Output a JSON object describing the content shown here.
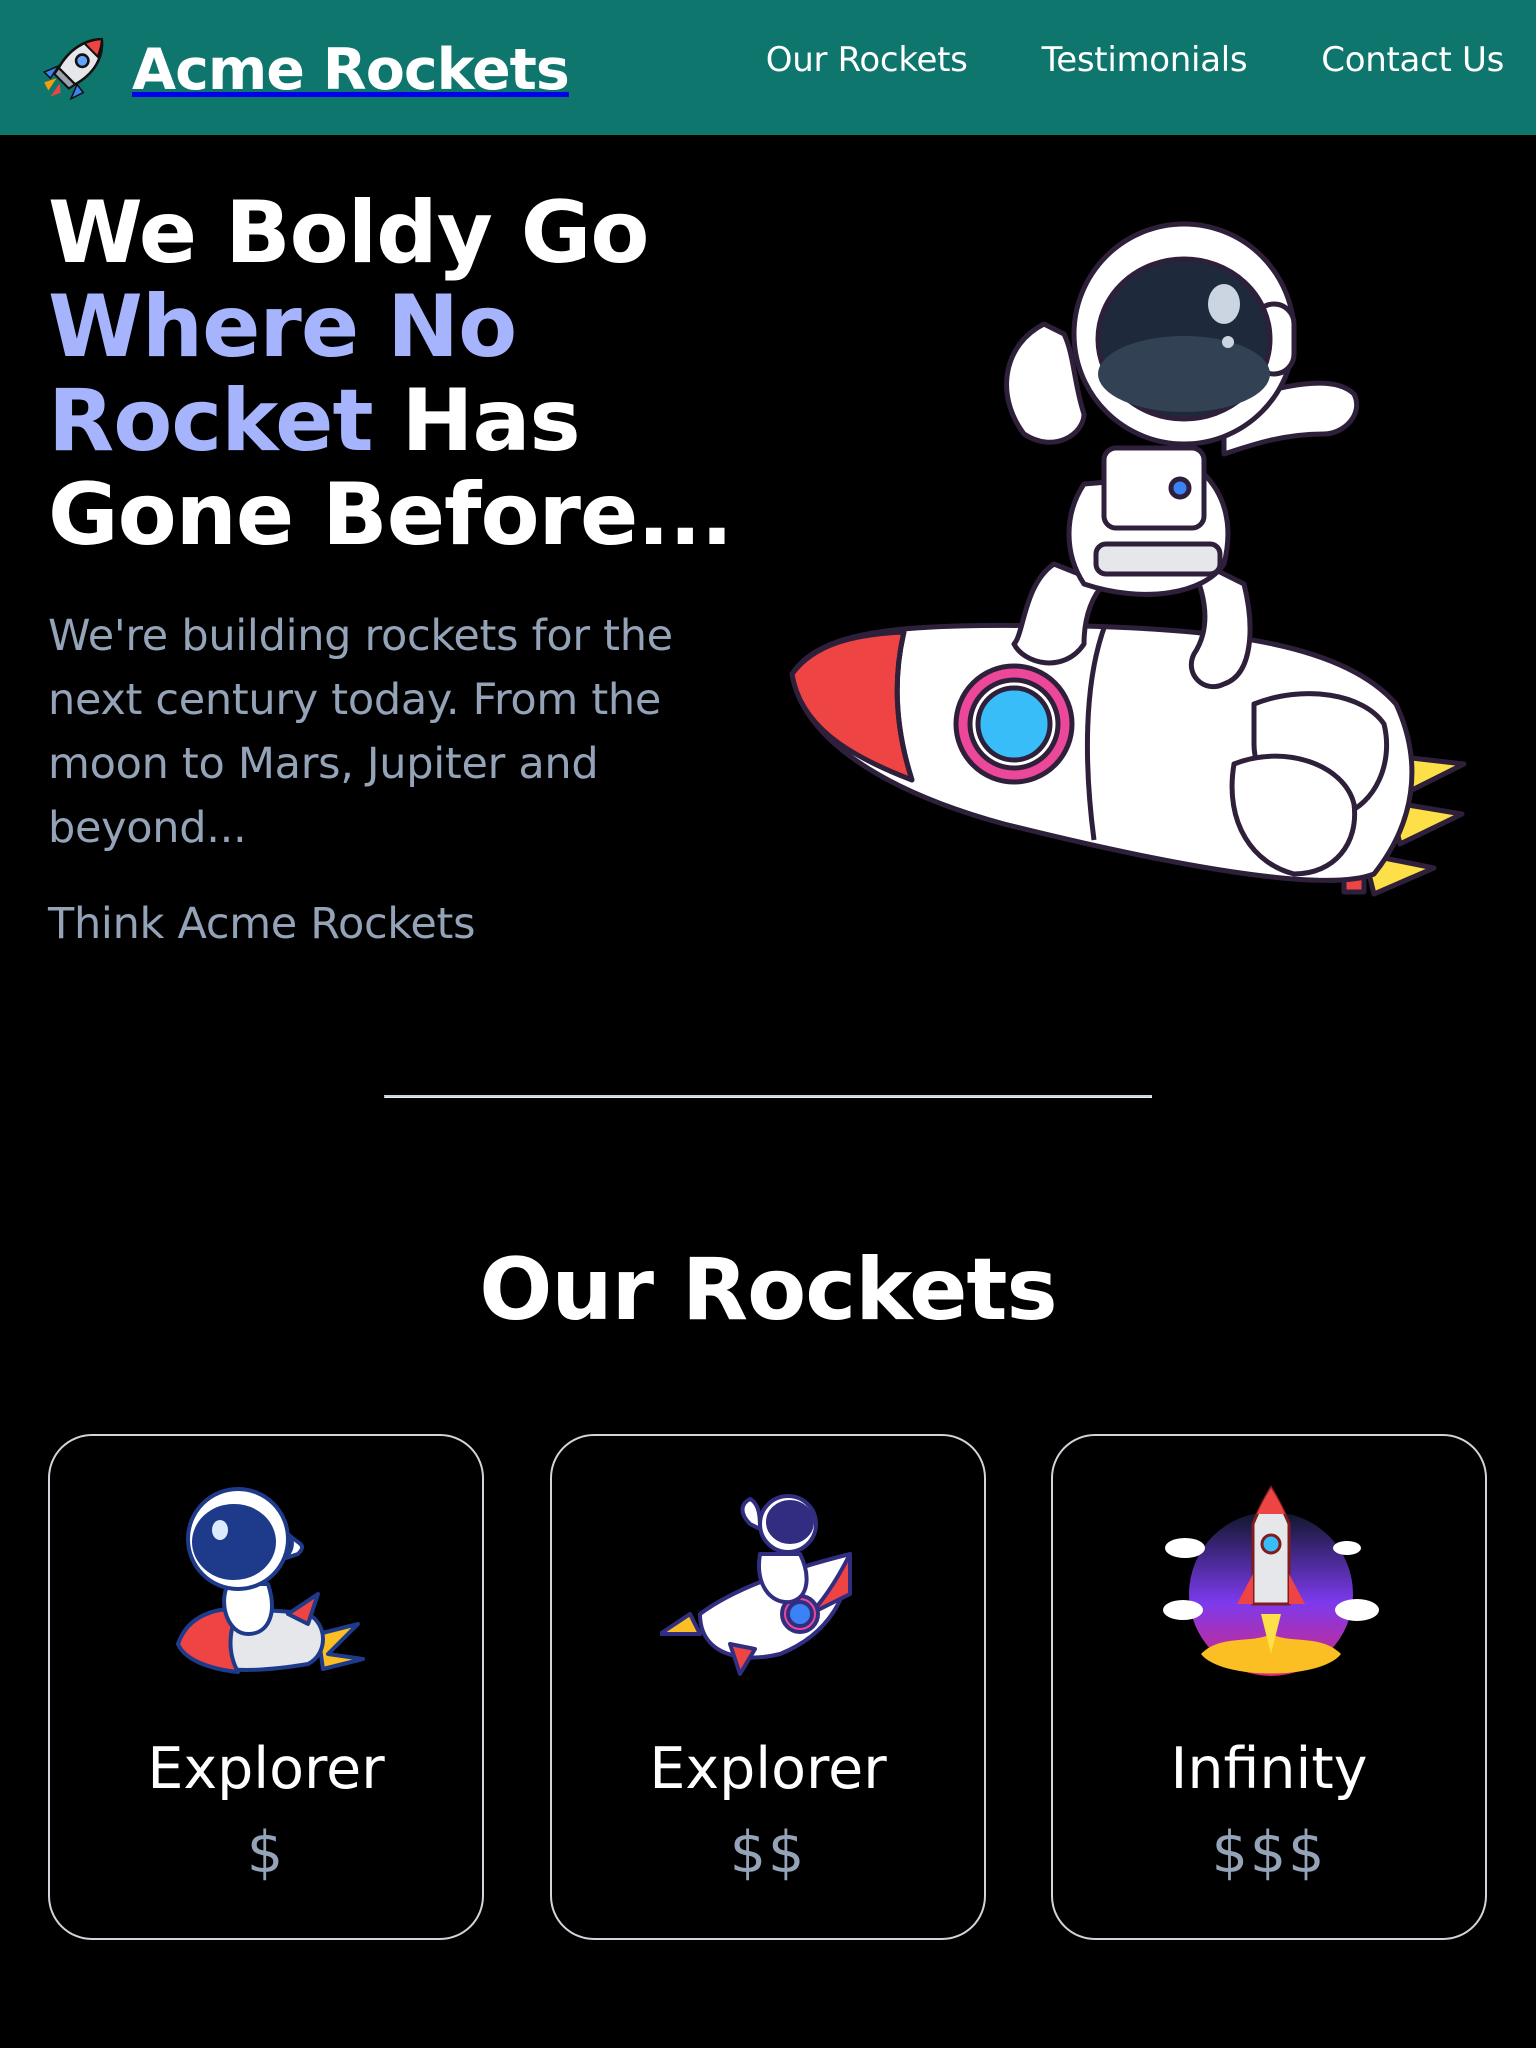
{
  "header": {
    "logo_icon": "rocket-icon",
    "brand": "Acme Rockets",
    "background_color": "#0f766e",
    "nav": [
      {
        "label": "Our Rockets"
      },
      {
        "label": "Testimonials"
      },
      {
        "label": "Contact Us"
      }
    ]
  },
  "hero": {
    "title_line1": "We Boldy Go",
    "title_accent": "Where No Rocket",
    "title_rest": " Has Gone Before...",
    "accent_color": "#a5b4fc",
    "description": "We're building rockets for the next century today. From the moon to Mars, Jupiter and beyond...",
    "tagline": "Think Acme Rockets",
    "image": "astronaut-dabbing-on-rocket-illustration"
  },
  "rockets_section": {
    "title": "Our Rockets",
    "cards": [
      {
        "name": "Explorer",
        "price": "$",
        "image": "astronaut-riding-rocket-illustration"
      },
      {
        "name": "Explorer",
        "price": "$$",
        "image": "astronaut-waving-on-rocket-illustration"
      },
      {
        "name": "Infinity",
        "price": "$$$",
        "image": "rocket-launch-illustration"
      }
    ]
  }
}
